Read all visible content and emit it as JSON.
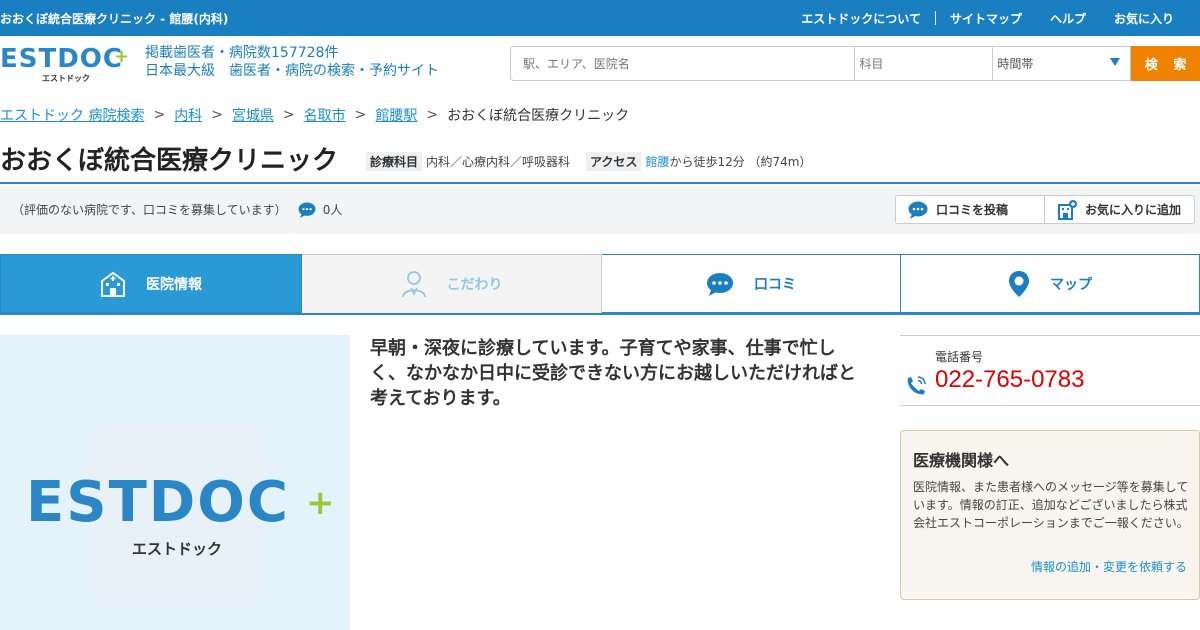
{
  "topbar": {
    "site_title": "おおくぼ統合医療クリニック - 館腰(内科)",
    "nav": [
      "エストドックについて",
      "サイトマップ",
      "ヘルプ",
      "お気に入り"
    ]
  },
  "header": {
    "logo_text": "ESTDOC",
    "logo_kana": "エストドック",
    "tagline_1": "掲載歯医者・病院数157728件",
    "tagline_2": "日本最大級　歯医者・病院の検索・予約サイト",
    "search": {
      "station_placeholder": "駅、エリア、医院名",
      "dept_placeholder": "科目",
      "time_value": "時間帯",
      "button_label": "検 索"
    }
  },
  "breadcrumb": {
    "items": [
      "エストドック 病院検索",
      "内科",
      "宮城県",
      "名取市",
      "館腰駅"
    ],
    "current": "おおくぼ統合医療クリニック"
  },
  "clinic": {
    "name": "おおくぼ統合医療クリニック",
    "dept_label": "診療科目",
    "dept_value": "内科／心療内科／呼吸器科",
    "access_label": "アクセス",
    "access_station": "館腰",
    "access_value": "から徒歩12分 （約74m）"
  },
  "review_bar": {
    "text": "（評価のない病院です、口コミを募集しています）",
    "count": "0人",
    "post_button": "口コミを投稿",
    "fav_button": "お気に入りに追加"
  },
  "tabs": [
    {
      "label": "医院情報"
    },
    {
      "label": "こだわり"
    },
    {
      "label": "口コミ"
    },
    {
      "label": "マップ"
    }
  ],
  "hero": {
    "logo_text": "ESTDOC",
    "logo_kana": "エストドック"
  },
  "intro": "早朝・深夜に診療しています。子育てや家事、仕事で忙しく、なかなか日中に受診できない方にお越しいただければと考えております。",
  "phone": {
    "label": "電話番号",
    "number": "022-765-0783"
  },
  "info_box": {
    "title": "医療機関様へ",
    "text": "医院情報、また患者様へのメッセージ等を募集しています。情報の訂正、追加などございましたら株式会社エストコーポレーションまでご一報ください。",
    "link": "情報の追加・変更を依頼する"
  },
  "colors": {
    "brand_blue": "#1a7fc1",
    "accent_orange": "#f08200",
    "phone_red": "#e00000",
    "logo_green": "#9cc838"
  }
}
